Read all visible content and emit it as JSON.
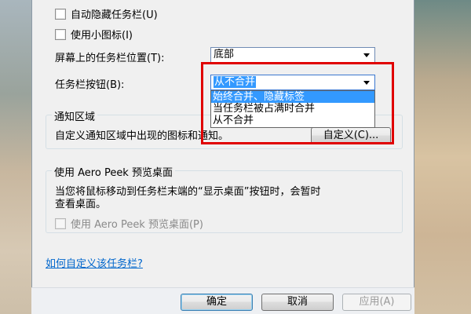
{
  "taskbar": {
    "autohide_label": "自动隐藏任务栏(U)",
    "small_icons_label": "使用小图标(I)",
    "location_label": "屏幕上的任务栏位置(T):",
    "location_value": "底部",
    "buttons_label": "任务栏按钮(B):",
    "buttons_value": "从不合并",
    "buttons_options": [
      "始终合并、隐藏标签",
      "当任务栏被占满时合并",
      "从不合并"
    ],
    "buttons_highlighted_option": "始终合并、隐藏标签"
  },
  "notification_area": {
    "title": "通知区域",
    "description": "自定义通知区域中出现的图标和通知。",
    "customize_button": "自定义(C)..."
  },
  "aero_peek": {
    "title": "使用 Aero Peek 预览桌面",
    "description_line1": "当您将鼠标移动到任务栏末端的“显示桌面”按钮时，会暂时",
    "description_line2": "查看桌面。",
    "checkbox_label": "使用 Aero Peek 预览桌面(P)"
  },
  "help_link": "如何自定义该任务栏?",
  "footer": {
    "ok": "确定",
    "cancel": "取消",
    "apply": "应用(A)"
  },
  "colors": {
    "highlight_box": "#e00000",
    "selection": "#3399ff",
    "link": "#0066cc"
  }
}
